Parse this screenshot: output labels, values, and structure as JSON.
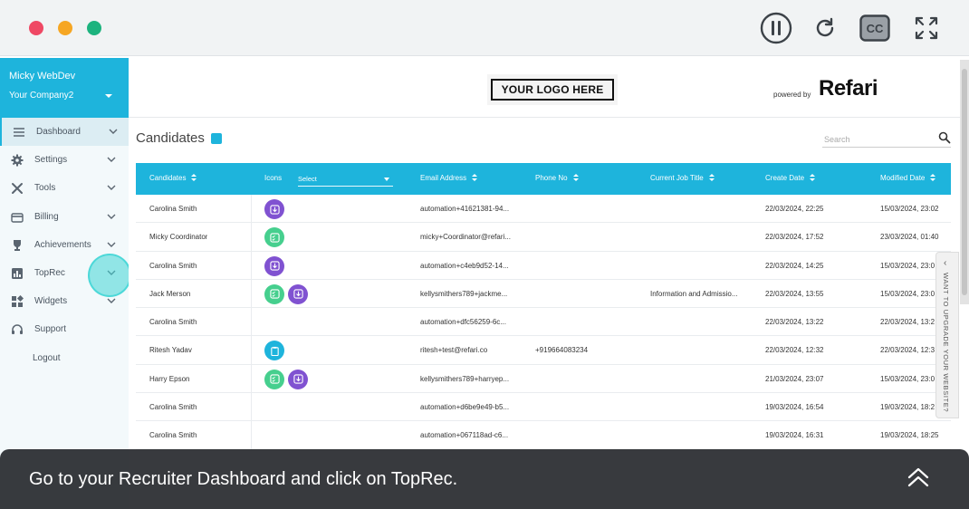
{
  "window": {
    "controls": [
      "pause-icon",
      "replay-icon",
      "closed-captions-icon",
      "fullscreen-icon"
    ],
    "cc_label": "CC"
  },
  "sidebar": {
    "user": "Micky WebDev",
    "company": "Your Company2",
    "items": [
      {
        "label": "Dashboard",
        "icon": "menu-icon",
        "active": true
      },
      {
        "label": "Settings",
        "icon": "gear-icon"
      },
      {
        "label": "Tools",
        "icon": "tools-icon"
      },
      {
        "label": "Billing",
        "icon": "card-icon"
      },
      {
        "label": "Achievements",
        "icon": "trophy-icon"
      },
      {
        "label": "TopRec",
        "icon": "bar-chart-icon"
      },
      {
        "label": "Widgets",
        "icon": "widgets-icon"
      },
      {
        "label": "Support",
        "icon": "headset-icon"
      },
      {
        "label": "Logout"
      }
    ]
  },
  "header": {
    "logo_text": "YOUR LOGO HERE",
    "powered_by": "powered by",
    "brand": "Refari"
  },
  "page": {
    "title": "Candidates",
    "search_placeholder": "Search"
  },
  "table": {
    "columns": {
      "candidates": "Candidates",
      "icons": "Icons",
      "icons_select": "Select",
      "email": "Email Address",
      "phone": "Phone No",
      "job_title": "Current Job Title",
      "create_date": "Create Date",
      "modified_date": "Modified Date"
    },
    "rows": [
      {
        "name": "Carolina Smith",
        "icons": [
          "download"
        ],
        "email": "automation+41621381-94...",
        "phone": "",
        "title": "",
        "created": "22/03/2024, 22:25",
        "modified": "15/03/2024, 23:02"
      },
      {
        "name": "Micky Coordinator",
        "icons": [
          "checklist"
        ],
        "email": "micky+Coordinator@refari...",
        "phone": "",
        "title": "",
        "created": "22/03/2024, 17:52",
        "modified": "23/03/2024, 01:40"
      },
      {
        "name": "Carolina Smith",
        "icons": [
          "download"
        ],
        "email": "automation+c4eb9d52-14...",
        "phone": "",
        "title": "",
        "created": "22/03/2024, 14:25",
        "modified": "15/03/2024, 23:0"
      },
      {
        "name": "Jack Merson",
        "icons": [
          "checklist",
          "download"
        ],
        "email": "kellysmithers789+jackme...",
        "phone": "",
        "title": "Information and Admissio...",
        "created": "22/03/2024, 13:55",
        "modified": "15/03/2024, 23:0"
      },
      {
        "name": "Carolina Smith",
        "icons": [],
        "email": "automation+dfc56259-6c...",
        "phone": "",
        "title": "",
        "created": "22/03/2024, 13:22",
        "modified": "22/03/2024, 13:2"
      },
      {
        "name": "Ritesh Yadav",
        "icons": [
          "clipboard"
        ],
        "email": "ritesh+test@refari.co",
        "phone": "+919664083234",
        "title": "",
        "created": "22/03/2024, 12:32",
        "modified": "22/03/2024, 12:3"
      },
      {
        "name": "Harry Epson",
        "icons": [
          "checklist",
          "download"
        ],
        "email": "kellysmithers789+harryep...",
        "phone": "",
        "title": "",
        "created": "21/03/2024, 23:07",
        "modified": "15/03/2024, 23:0"
      },
      {
        "name": "Carolina Smith",
        "icons": [],
        "email": "automation+d6be9e49-b5...",
        "phone": "",
        "title": "",
        "created": "19/03/2024, 16:54",
        "modified": "19/03/2024, 18:2"
      },
      {
        "name": "Carolina Smith",
        "icons": [],
        "email": "automation+067118ad-c6...",
        "phone": "",
        "title": "",
        "created": "19/03/2024, 16:31",
        "modified": "19/03/2024, 18:25"
      }
    ]
  },
  "side_tab": {
    "text": "WANT TO UPGRADE YOUR WEBSITE?"
  },
  "caption": {
    "text": "Go to your Recruiter Dashboard and click on TopRec."
  },
  "colors": {
    "accent": "#1eb4dc",
    "purple_badge": "#8052d1",
    "green_badge": "#46cf8e",
    "caption_bg": "#1c1f23"
  }
}
